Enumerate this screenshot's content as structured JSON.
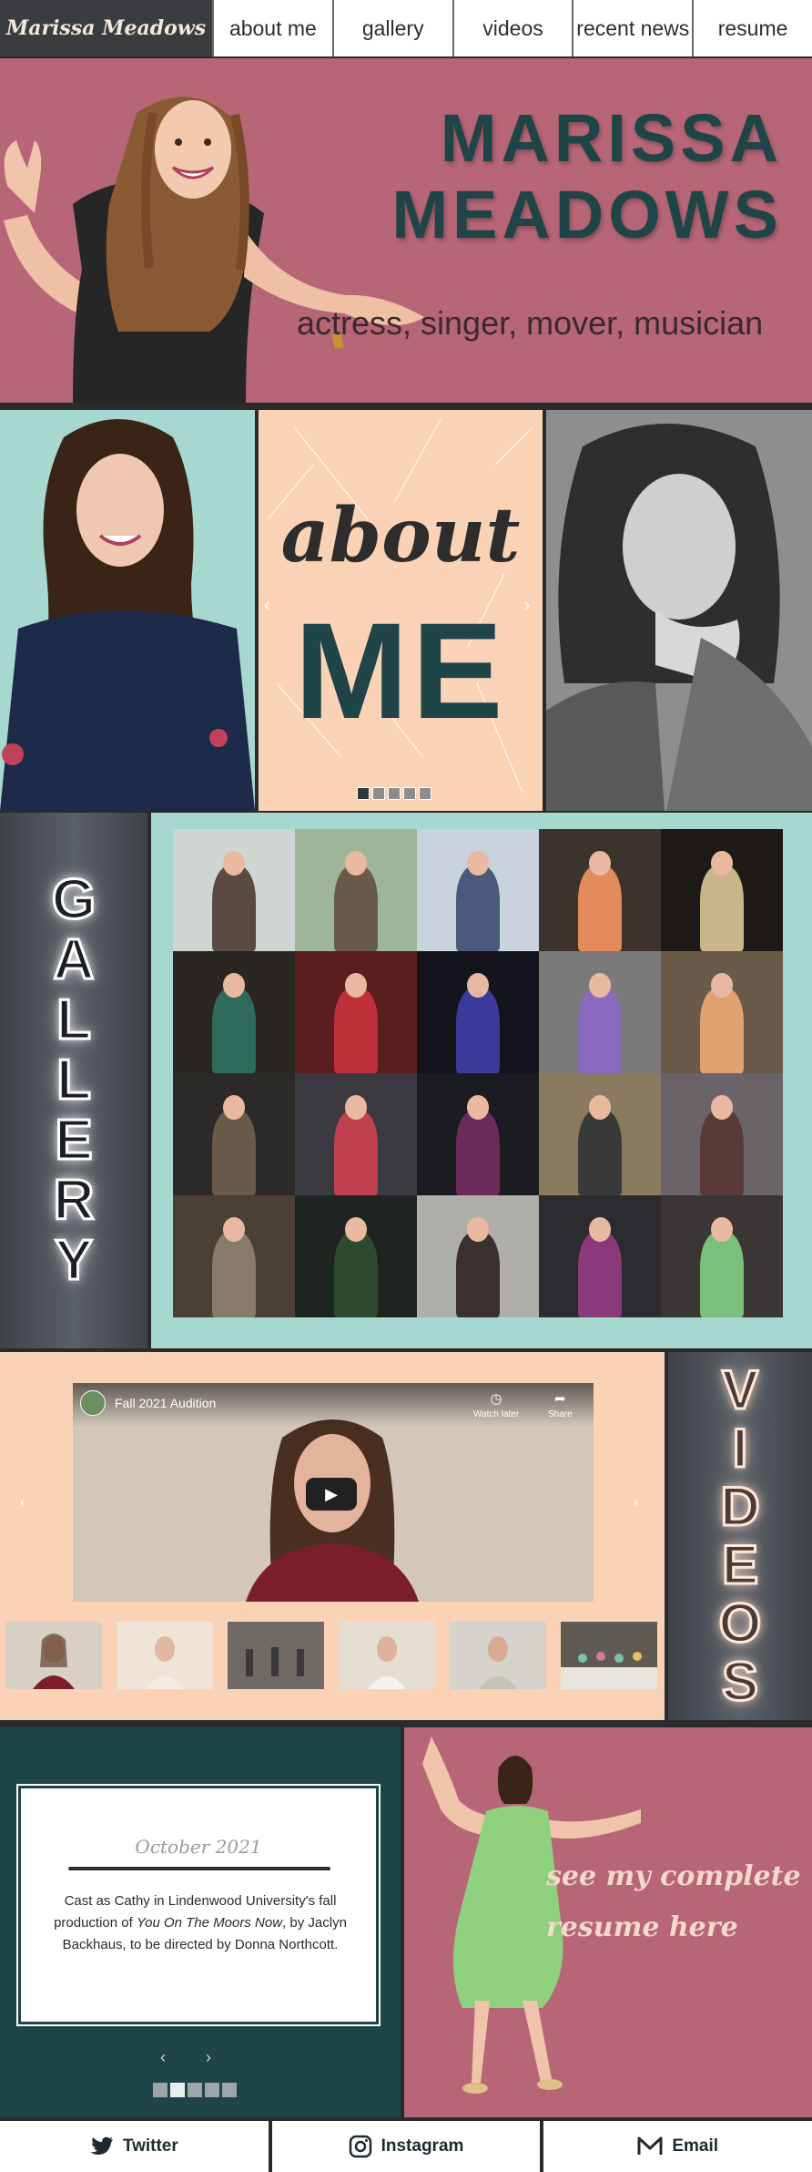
{
  "nav": {
    "brand": "Marissa Meadows",
    "items": [
      {
        "label": "about me"
      },
      {
        "label": "gallery"
      },
      {
        "label": "videos"
      },
      {
        "label": "recent news"
      },
      {
        "label": "resume"
      }
    ]
  },
  "hero": {
    "title_line1": "MARISSA",
    "title_line2": "MEADOWS",
    "tagline": "actress, singer, mover, musician"
  },
  "about": {
    "word1": "about",
    "word2": "ME",
    "slides_total": 5,
    "slide_active": 1
  },
  "gallery": {
    "label_letters": [
      "G",
      "A",
      "L",
      "L",
      "E",
      "R",
      "Y"
    ],
    "photos_count": 20
  },
  "videos": {
    "label_letters": [
      "V",
      "I",
      "D",
      "E",
      "O",
      "S"
    ],
    "player": {
      "title": "Fall 2021 Audition",
      "watch_later": "Watch later",
      "share": "Share"
    },
    "thumbnail_count": 6
  },
  "news": {
    "date": "October 2021",
    "body_before": "Cast as Cathy in Lindenwood University's fall production of ",
    "body_title": "You On The Moors Now",
    "body_after": ", by Jaclyn Backhaus, to be directed by Donna Northcott.",
    "slides_total": 5,
    "slide_active": 2
  },
  "resume": {
    "line1": "see my complete",
    "line2": "resume here"
  },
  "social": {
    "twitter": "Twitter",
    "instagram": "Instagram",
    "email": "Email"
  },
  "colors": {
    "rose": "#b66676",
    "mint": "#a7d8d0",
    "peach": "#fad3b7",
    "teal_dark": "#1f4548",
    "charcoal": "#2b2b2b"
  }
}
